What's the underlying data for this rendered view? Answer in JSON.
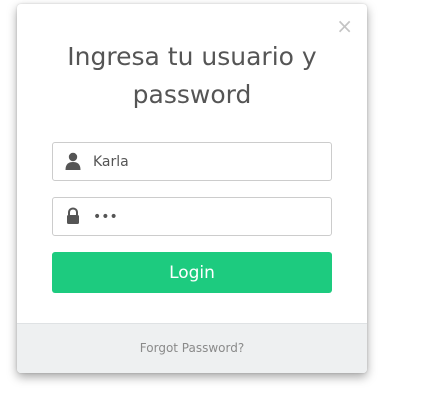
{
  "modal": {
    "close_symbol": "×",
    "title_line1": "Ingresa tu usuario y",
    "title_line2": "password"
  },
  "form": {
    "username_value": "Karla",
    "username_icon": "user-icon",
    "password_value": "•••",
    "password_icon": "lock-icon",
    "login_label": "Login"
  },
  "footer": {
    "forgot_label": "Forgot Password?"
  },
  "colors": {
    "login_button": "#1dcb7f",
    "footer_bg": "#eef0f1",
    "title_text": "#555555"
  }
}
